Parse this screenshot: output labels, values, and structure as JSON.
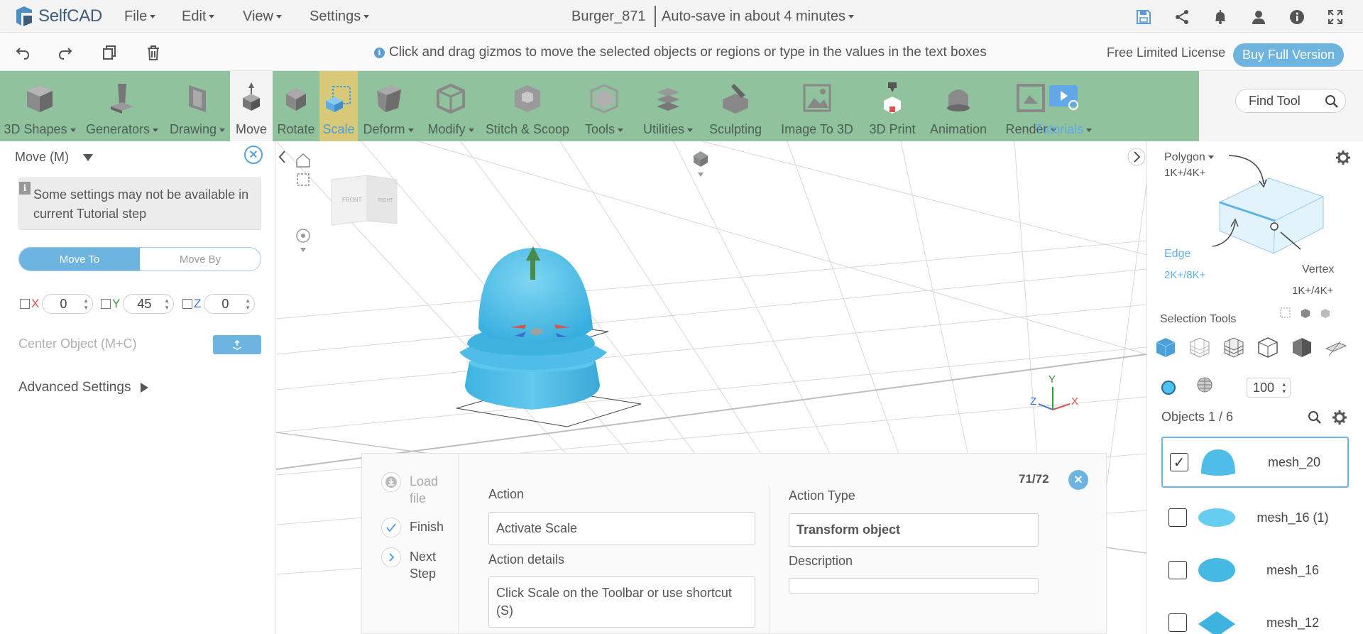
{
  "app": {
    "logo_text": "SelfCAD",
    "menus": [
      "File",
      "Edit",
      "View",
      "Settings"
    ],
    "document_title": "Burger_871",
    "autosave": "Auto-save in about 4 minutes",
    "top_icons": [
      "save-icon",
      "share-icon",
      "bell-icon",
      "user-icon",
      "info-icon",
      "fullscreen-icon"
    ]
  },
  "bar2": {
    "hint": "Click and drag gizmos to move the selected objects or regions or type in the values in the text boxes",
    "license": "Free Limited License",
    "buy": "Buy Full Version",
    "icons": [
      "undo-icon",
      "redo-icon",
      "copy-icon",
      "delete-icon"
    ]
  },
  "toolbar": {
    "tools": [
      {
        "label": "3D Shapes",
        "dropdown": true
      },
      {
        "label": "Generators",
        "dropdown": true
      },
      {
        "label": "Drawing",
        "dropdown": true
      },
      {
        "label": "Move",
        "dropdown": false
      },
      {
        "label": "Rotate",
        "dropdown": false
      },
      {
        "label": "Scale",
        "dropdown": false
      },
      {
        "label": "Deform",
        "dropdown": true
      },
      {
        "label": "Modify",
        "dropdown": true
      },
      {
        "label": "Stitch & Scoop",
        "dropdown": false
      },
      {
        "label": "Tools",
        "dropdown": true
      },
      {
        "label": "Utilities",
        "dropdown": true
      },
      {
        "label": "Sculpting",
        "dropdown": false
      },
      {
        "label": "Image To 3D",
        "dropdown": false
      },
      {
        "label": "3D Print",
        "dropdown": false
      },
      {
        "label": "Animation",
        "dropdown": false
      },
      {
        "label": "Render",
        "dropdown": true
      },
      {
        "label": "Tutorials",
        "dropdown": true
      }
    ],
    "find_tool": "Find Tool"
  },
  "left_panel": {
    "title": "Move (M)",
    "notice": "Some settings may not be available in current Tutorial step",
    "move_to": "Move To",
    "move_by": "Move By",
    "axes": [
      {
        "label": "X",
        "value": "0",
        "color": "#d9534f"
      },
      {
        "label": "Y",
        "value": "45",
        "color": "#3a9a3a"
      },
      {
        "label": "Z",
        "value": "0",
        "color": "#3a6fd0"
      }
    ],
    "center_object": "Center Object (M+C)",
    "advanced": "Advanced Settings"
  },
  "viewport": {
    "cube_front": "FRONT",
    "cube_right": "RIGHT",
    "axis_x": "X",
    "axis_y": "Y",
    "axis_z": "Z"
  },
  "right_panel": {
    "polygon": "Polygon",
    "polygon_count": "1K+/4K+",
    "edge": "Edge",
    "edge_count": "2K+/8K+",
    "vertex": "Vertex",
    "vertex_count": "1K+/4K+",
    "selection_tools": "Selection Tools",
    "percent": "100",
    "objects": "Objects 1 / 6",
    "items": [
      {
        "name": "mesh_20",
        "checked": true
      },
      {
        "name": "mesh_16 (1)",
        "checked": false
      },
      {
        "name": "mesh_16",
        "checked": false
      },
      {
        "name": "mesh_12",
        "checked": false
      }
    ]
  },
  "tutorial": {
    "steps": [
      {
        "label": "Load file"
      },
      {
        "label": "Finish"
      },
      {
        "label": "Next Step"
      }
    ],
    "action_label": "Action",
    "action_value": "Activate Scale",
    "action_details_label": "Action details",
    "action_details_value": "Click Scale on the Toolbar or use shortcut (S)",
    "action_type_label": "Action Type",
    "action_type_value": "Transform object",
    "description_label": "Description",
    "description_value": "",
    "counter": "71/72"
  },
  "colors": {
    "toolbar_green": "#8fc29d",
    "accent_blue": "#6eb4e0",
    "mesh_blue": "#4fc3e8"
  }
}
